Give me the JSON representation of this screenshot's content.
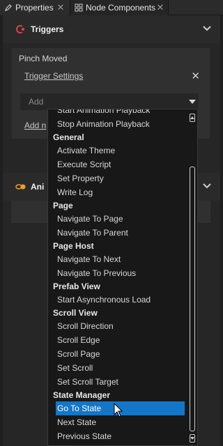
{
  "tabs": [
    {
      "label": "Properties",
      "icon": "pencil-icon",
      "close": "✕"
    },
    {
      "label": "Node Components",
      "icon": "components-icon",
      "close": "✕"
    }
  ],
  "triggers_section": {
    "title": "Triggers",
    "card": {
      "title": "Pinch Moved",
      "trigger_settings": "Trigger Settings",
      "remove": "✕",
      "add_placeholder": "Add",
      "add_new": "Add n"
    }
  },
  "anim_section": {
    "title": "Ani"
  },
  "dropdown": {
    "items": [
      {
        "text": "Start Animation Playback",
        "kind": "item"
      },
      {
        "text": "Stop Animation Playback",
        "kind": "item"
      },
      {
        "text": "General",
        "kind": "category"
      },
      {
        "text": "Activate Theme",
        "kind": "item"
      },
      {
        "text": "Execute Script",
        "kind": "item"
      },
      {
        "text": "Set Property",
        "kind": "item"
      },
      {
        "text": "Write Log",
        "kind": "item"
      },
      {
        "text": "Page",
        "kind": "category"
      },
      {
        "text": "Navigate To Page",
        "kind": "item"
      },
      {
        "text": "Navigate To Parent",
        "kind": "item"
      },
      {
        "text": "Page Host",
        "kind": "category"
      },
      {
        "text": "Navigate To Next",
        "kind": "item"
      },
      {
        "text": "Navigate To Previous",
        "kind": "item"
      },
      {
        "text": "Prefab View",
        "kind": "category"
      },
      {
        "text": "Start Asynchronous Load",
        "kind": "item"
      },
      {
        "text": "Scroll View",
        "kind": "category"
      },
      {
        "text": "Scroll Direction",
        "kind": "item"
      },
      {
        "text": "Scroll Edge",
        "kind": "item"
      },
      {
        "text": "Scroll Page",
        "kind": "item"
      },
      {
        "text": "Set Scroll",
        "kind": "item"
      },
      {
        "text": "Set Scroll Target",
        "kind": "item"
      },
      {
        "text": "State Manager",
        "kind": "category"
      },
      {
        "text": "Go To State",
        "kind": "item",
        "selected": true
      },
      {
        "text": "Next State",
        "kind": "item"
      },
      {
        "text": "Previous State",
        "kind": "item"
      }
    ]
  },
  "colors": {
    "selection": "#1277c8",
    "background": "#1f1f1f",
    "trigger_icon": "#e0404a",
    "anim_icon": "#f0a020"
  }
}
